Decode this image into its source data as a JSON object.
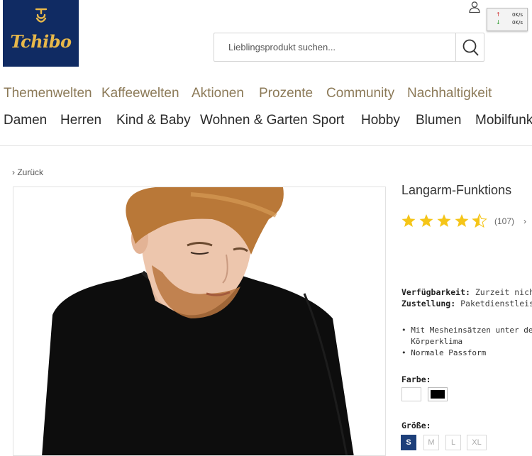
{
  "brand": {
    "logo_text": "Tchibo"
  },
  "speed": {
    "upload": "0K/s",
    "download": "0K/s",
    "upload_arrow": "↑",
    "download_arrow": "↓"
  },
  "search": {
    "placeholder": "Lieblingsprodukt suchen..."
  },
  "nav_top": [
    "Themenwelten",
    "Kaffeewelten",
    "Aktionen",
    "Prozente",
    "Community",
    "Nachhaltigkeit"
  ],
  "nav_bottom": [
    "Damen",
    "Herren",
    "Kind & Baby",
    "Wohnen & Garten",
    "Sport",
    "Hobby",
    "Blumen",
    "Mobilfunk"
  ],
  "back": {
    "label": "Zurück"
  },
  "product": {
    "title": "Langarm-Funktions",
    "rating_value": 4.5,
    "rating_count": "(107)",
    "availability_label": "Verfügbarkeit:",
    "availability_value": "Zurzeit nicht v",
    "delivery_label": "Zustellung:",
    "delivery_value": "Paketdienstleister",
    "features": [
      "Mit Mesheinsätzen unter den A",
      "Körperklima",
      "Normale Passform"
    ],
    "color_label": "Farbe:",
    "colors": [
      {
        "name": "weiß",
        "hex": "#ffffff"
      },
      {
        "name": "schwarz",
        "hex": "#000000"
      }
    ],
    "size_label": "Größe:",
    "sizes": [
      "S",
      "M",
      "L",
      "XL"
    ],
    "selected_size": "S"
  },
  "colors": {
    "brand_navy": "#102b63",
    "brand_gold": "#e8b84a",
    "nav_top_text": "#8c7a58",
    "star": "#f5c518",
    "selected_size": "#1d3f7a"
  }
}
